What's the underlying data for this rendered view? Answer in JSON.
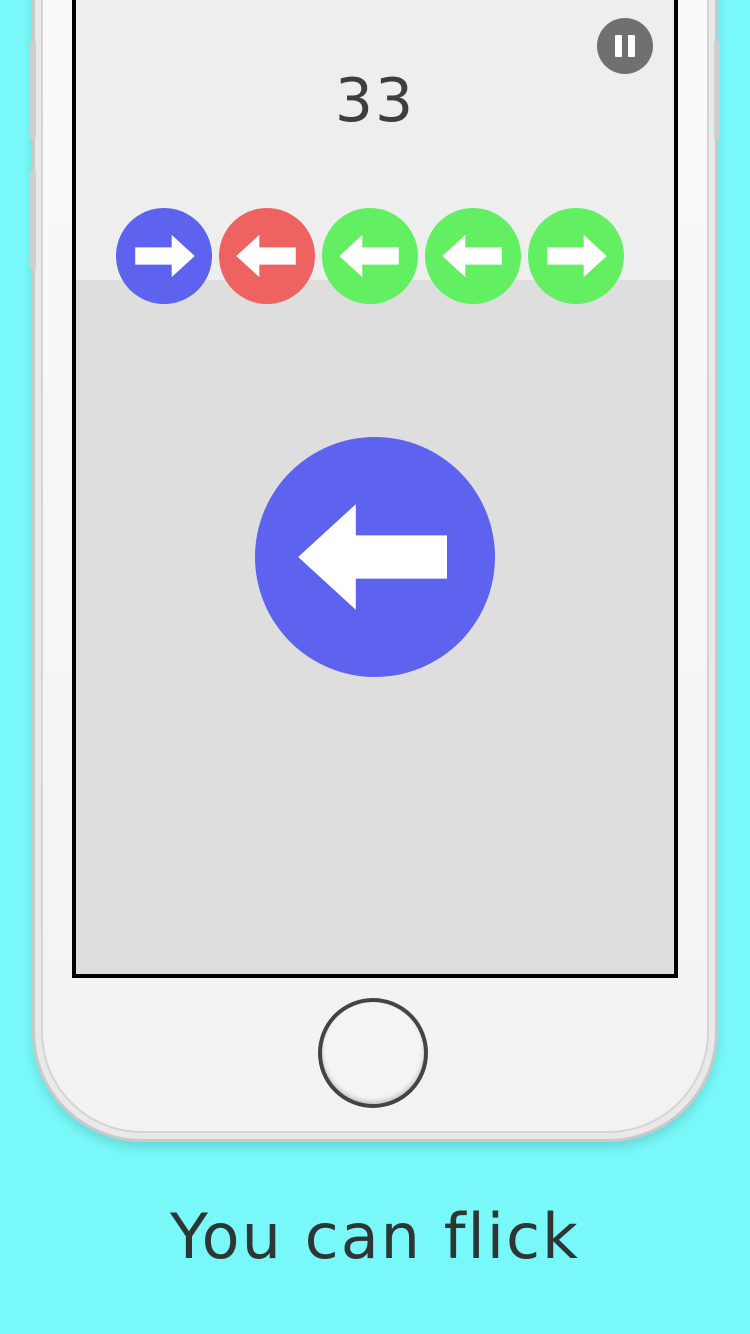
{
  "game": {
    "score": "33",
    "queue": [
      {
        "color": "#5d62ef",
        "direction": "right"
      },
      {
        "color": "#ef6262",
        "direction": "left"
      },
      {
        "color": "#62ef62",
        "direction": "left"
      },
      {
        "color": "#62ef62",
        "direction": "left"
      },
      {
        "color": "#62ef62",
        "direction": "right"
      }
    ],
    "current": {
      "color": "#5d62ef",
      "direction": "left"
    },
    "pause_icon": "pause-icon"
  },
  "caption": "You can flick",
  "colors": {
    "background": "#78f8f8",
    "blue": "#5d62ef",
    "red": "#ef6262",
    "green": "#62ef62"
  }
}
